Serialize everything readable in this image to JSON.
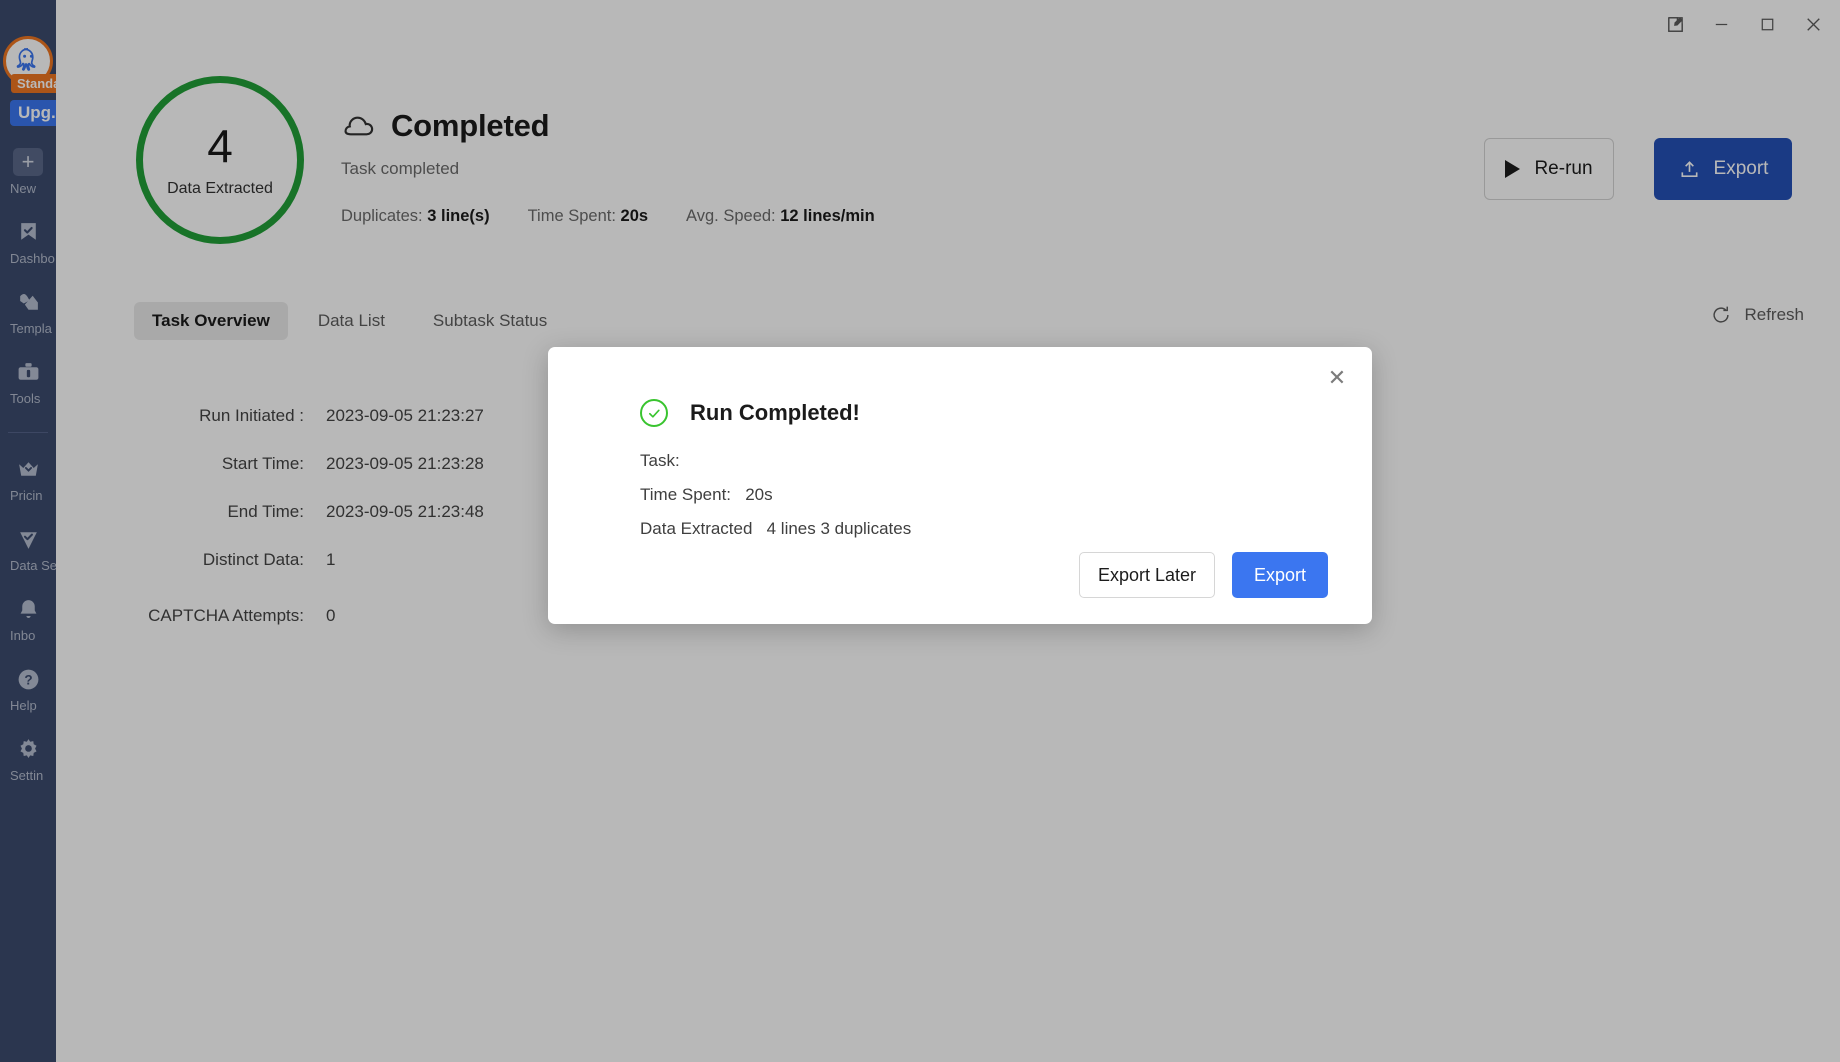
{
  "sidebar": {
    "account_badge": "Standard",
    "upgrade_label": "Upg.",
    "items": [
      {
        "label": "New",
        "icon": "plus-icon"
      },
      {
        "label": "Dashbo",
        "icon": "bookmark-check-icon"
      },
      {
        "label": "Templa",
        "icon": "templates-icon"
      },
      {
        "label": "Tools",
        "icon": "toolbox-icon"
      },
      {
        "label": "Pricin",
        "icon": "crown-icon"
      },
      {
        "label": "Data Se",
        "icon": "shield-check-icon"
      },
      {
        "label": "Inbo",
        "icon": "bell-icon"
      },
      {
        "label": "Help",
        "icon": "question-circle-icon"
      },
      {
        "label": "Settin",
        "icon": "gear-icon"
      }
    ]
  },
  "titlebar": {
    "buttons": [
      {
        "name": "edit-window-icon",
        "glyph": "edit-square"
      },
      {
        "name": "minimize-icon",
        "glyph": "minimize"
      },
      {
        "name": "maximize-icon",
        "glyph": "maximize"
      },
      {
        "name": "close-icon",
        "glyph": "close"
      }
    ]
  },
  "header": {
    "ring_value": "4",
    "ring_label": "Data Extracted",
    "ring_color": "#22a038",
    "status_title": "Completed",
    "status_icon": "cloud-icon",
    "status_sub": "Task completed",
    "stats": [
      {
        "label": "Duplicates:",
        "value": "3 line(s)"
      },
      {
        "label": "Time Spent:",
        "value": "20s"
      },
      {
        "label": "Avg. Speed:",
        "value": "12 lines/min"
      }
    ],
    "rerun_label": "Re-run",
    "export_label": "Export",
    "export_color": "#2451b8"
  },
  "tabs": [
    {
      "label": "Task Overview",
      "active": true
    },
    {
      "label": "Data List",
      "active": false
    },
    {
      "label": "Subtask Status",
      "active": false
    }
  ],
  "refresh_label": "Refresh",
  "overview": {
    "rows": [
      {
        "label": "Run Initiated :",
        "value": "2023-09-05 21:23:27"
      },
      {
        "label": "Start Time:",
        "value": "2023-09-05 21:23:28"
      },
      {
        "label": "End Time:",
        "value": "2023-09-05 21:23:48"
      },
      {
        "label": "Distinct Data:",
        "value": "1"
      },
      {
        "label": "CAPTCHA Attempts:",
        "value": "0"
      }
    ]
  },
  "modal": {
    "title": "Run Completed!",
    "icon": "check-circle-icon",
    "close_label": "✕",
    "lines": [
      "Task:",
      "Time Spent:   20s",
      "Data Extracted   4 lines 3 duplicates"
    ],
    "secondary_label": "Export Later",
    "primary_label": "Export",
    "primary_color": "#3b76f0"
  }
}
